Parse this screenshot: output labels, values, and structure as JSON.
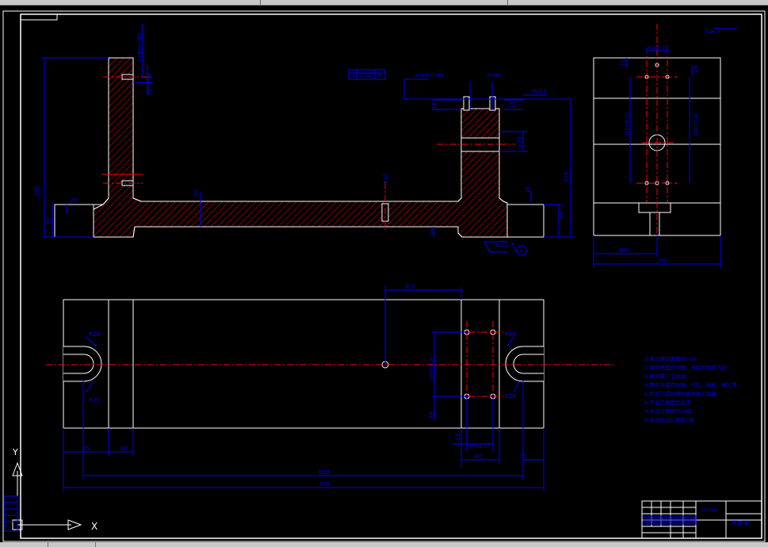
{
  "colors": {
    "background": "#000000",
    "outline": "#ffffff",
    "dimension": "#0000ff",
    "centerline": "#ff0000",
    "hatch": "#ff0000",
    "ucs": "#ffffff"
  },
  "front_view": {
    "dim_top_stack": "2×Φ8H7/Φ8",
    "dim_top_hole": "Φ8H7/Φ8",
    "dim_24": "24",
    "dim_2x_phi8": "2×Φ8",
    "dim_bolt": "2×Φ8H7/Φ8",
    "tolerance_frame_symbol": "//",
    "tolerance_frame_value": "0.02",
    "tolerance_frame_datum": "A",
    "roughness_top": "Ra3.2",
    "dim_12a": "12",
    "dim_12b": "12",
    "dim_285": "285",
    "dim_100_vertical": "100",
    "dim_total_height": "315",
    "dim_30": "30",
    "dim_slot": "Φ12",
    "dim_10": "10",
    "dim_50_left": "50",
    "dim_50_right": "50",
    "dim_20_left": "20",
    "dim_25": "25",
    "roughness_bottom": "Ra3.2",
    "datum_label": "A"
  },
  "side_view": {
    "roughness_corner": "Ra6.3",
    "dim_top": "40±0.10",
    "dim_12": "12",
    "dim_160a": "160±0.10",
    "dim_160b": "160±0.10",
    "dim_24": "24",
    "dim_100": "100",
    "dim_200": "200"
  },
  "top_view": {
    "dim_115": "115",
    "dim_r28_left": "R28",
    "dim_r15_left": "R15",
    "dim_r28_right": "R28",
    "dim_r15_right": "R15",
    "dim_100_vertical": "100±0.10",
    "dim_40": "40",
    "dim_40_horizontal": "40±0.10",
    "dim_12": "12",
    "dim_80": "80",
    "dim_65": "65",
    "dim_40_small": "40",
    "dim_75": "75",
    "dim_600": "600",
    "dim_750": "750"
  },
  "notes": [
    "1.未注铸造圆角R5-10",
    "2.铸件表面应平整，去除毛刺和飞边",
    "3.铸件需人工时效",
    "4.铸件不得有砂眼，气孔，缩松，缩孔等",
    "5.机加工前划线检查各加工余量",
    "6.不加工表面涂底漆",
    "7.未注公差按IT14级",
    "8.未注形位公差按C级"
  ],
  "title_block": {
    "material": "HT200",
    "drawing_name": "夹具体"
  },
  "ucs": {
    "x_label": "X",
    "y_label": "Y"
  }
}
